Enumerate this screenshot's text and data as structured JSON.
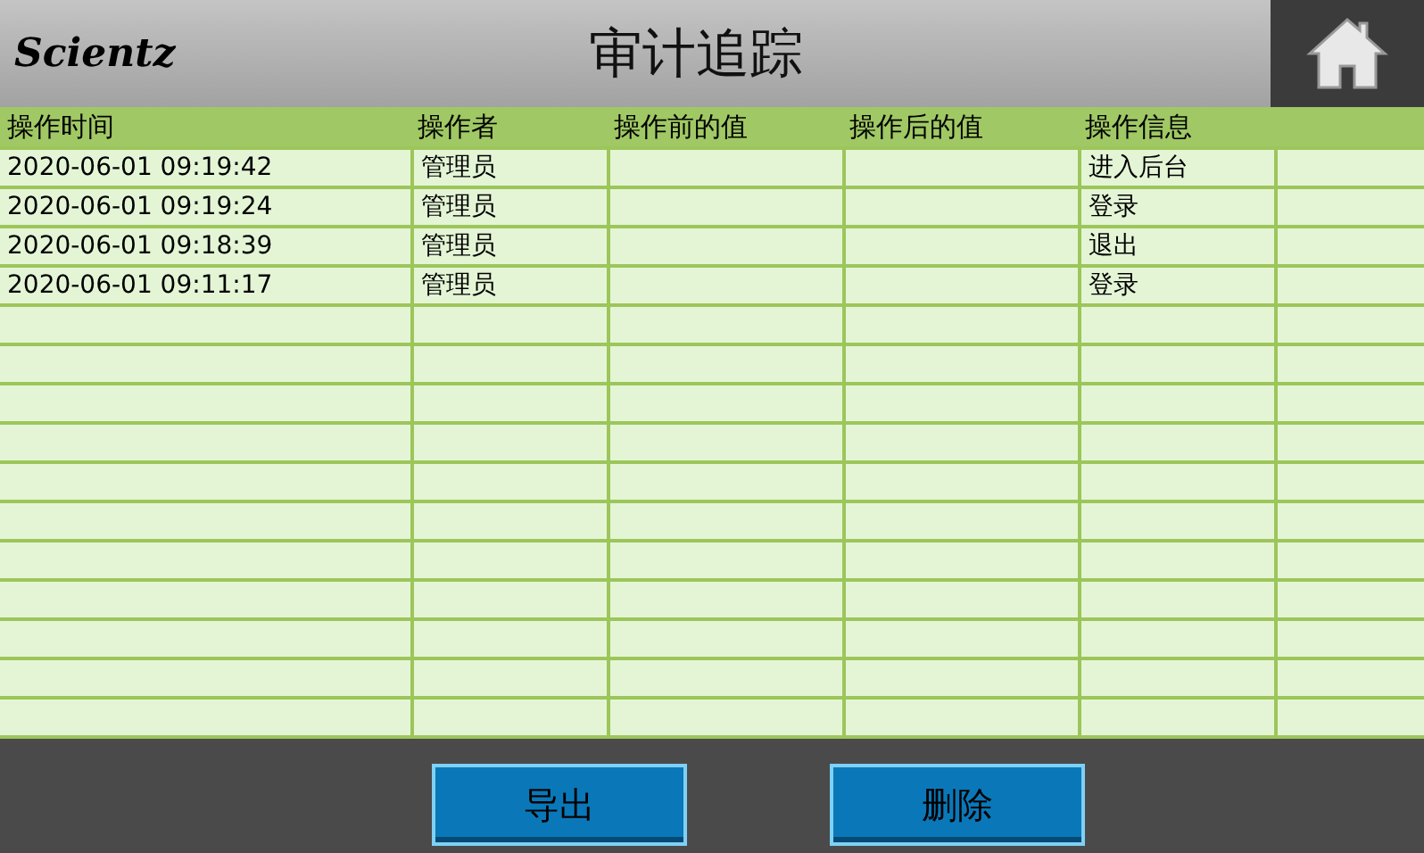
{
  "header": {
    "logo": "Scientz",
    "title": "审计追踪"
  },
  "table": {
    "columns": [
      "操作时间",
      "操作者",
      "操作前的值",
      "操作后的值",
      "操作信息"
    ],
    "rows": [
      {
        "time": "2020-06-01 09:19:42",
        "operator": "管理员",
        "info": "进入后台"
      },
      {
        "time": "2020-06-01 09:19:24",
        "operator": "管理员",
        "info": "登录"
      },
      {
        "time": "2020-06-01 09:18:39",
        "operator": "管理员",
        "info": "退出"
      },
      {
        "time": "2020-06-01 09:11:17",
        "operator": "管理员",
        "info": "登录"
      }
    ]
  },
  "buttons": [
    "导出",
    "删除"
  ]
}
